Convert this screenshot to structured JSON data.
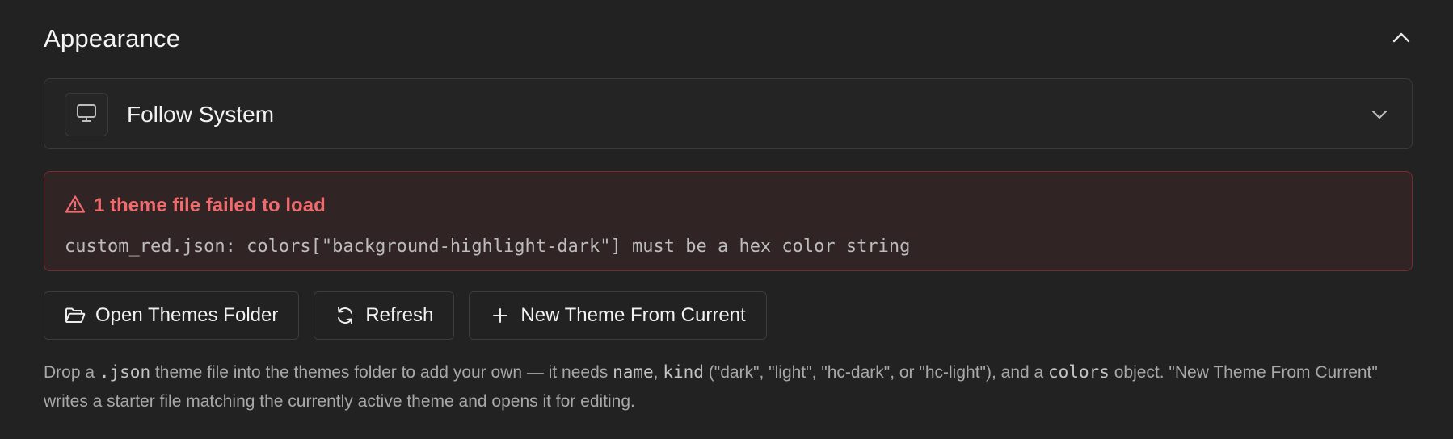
{
  "section": {
    "title": "Appearance",
    "collapse_icon": "chevron-up-icon"
  },
  "theme_select": {
    "icon": "monitor-icon",
    "value": "Follow System",
    "chevron_icon": "chevron-down-icon"
  },
  "error": {
    "icon": "warning-triangle-icon",
    "title": "1 theme file failed to load",
    "detail": "custom_red.json: colors[\"background-highlight-dark\"] must be a hex color string",
    "color": "#f06a6e"
  },
  "buttons": [
    {
      "icon": "folder-open-icon",
      "label": "Open Themes Folder"
    },
    {
      "icon": "refresh-icon",
      "label": "Refresh"
    },
    {
      "icon": "plus-icon",
      "label": "New Theme From Current"
    }
  ],
  "help": {
    "p1": "Drop a ",
    "code1": ".json",
    "p2": " theme file into the themes folder to add your own — it needs ",
    "code2": "name",
    "p3": ", ",
    "code3": "kind",
    "p4": " (\"dark\", \"light\", \"hc-dark\", or \"hc-light\"), and a ",
    "code4": "colors",
    "p5": " object. \"New Theme From Current\" writes a starter file matching the currently active theme and opens it for editing."
  }
}
